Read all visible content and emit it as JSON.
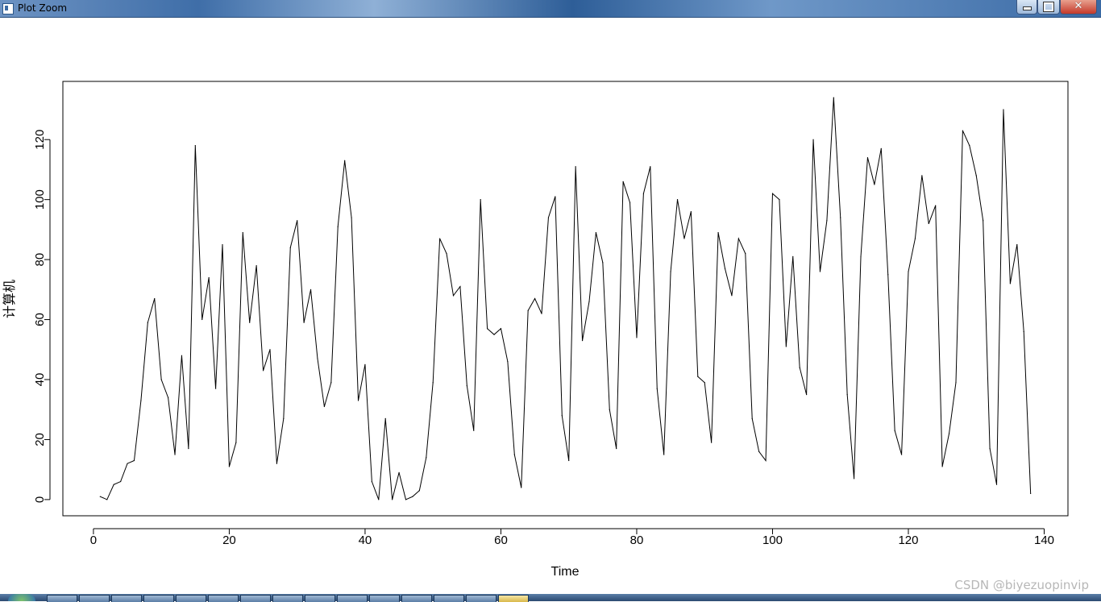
{
  "window": {
    "title": "Plot Zoom",
    "minimize_glyph": "",
    "maximize_glyph": "",
    "close_glyph": "✕"
  },
  "watermark": "CSDN @biyezuopinvip",
  "chart_data": {
    "type": "line",
    "title": "",
    "xlabel": "Time",
    "ylabel": "计算机",
    "xlim": [
      -4.5,
      143.5
    ],
    "ylim": [
      -5.4,
      139.4
    ],
    "xticks": [
      0,
      20,
      40,
      60,
      80,
      100,
      120,
      140
    ],
    "yticks": [
      0,
      20,
      40,
      60,
      80,
      100,
      120
    ],
    "grid": false,
    "line_color": "#000000",
    "series": [
      {
        "x": [
          1,
          2,
          3,
          4,
          5,
          6,
          7,
          8,
          9,
          10,
          11,
          12,
          13,
          14,
          15,
          16,
          17,
          18,
          19,
          20,
          21,
          22,
          23,
          24,
          25,
          26,
          27,
          28,
          29,
          30,
          31,
          32,
          33,
          34,
          35,
          36,
          37,
          38,
          39,
          40,
          41,
          42,
          43,
          44,
          45,
          46,
          47,
          48,
          49,
          50,
          51,
          52,
          53,
          54,
          55,
          56,
          57,
          58,
          59,
          60,
          61,
          62,
          63,
          64,
          65,
          66,
          67,
          68,
          69,
          70,
          71,
          72,
          73,
          74,
          75,
          76,
          77,
          78,
          79,
          80,
          81,
          82,
          83,
          84,
          85,
          86,
          87,
          88,
          89,
          90,
          91,
          92,
          93,
          94,
          95,
          96,
          97,
          98,
          99,
          100,
          101,
          102,
          103,
          104,
          105,
          106,
          107,
          108,
          109,
          110,
          111,
          112,
          113,
          114,
          115,
          116,
          117,
          118,
          119,
          120,
          121,
          122,
          123,
          124,
          125,
          126,
          127,
          128,
          129,
          130,
          131,
          132,
          133,
          134,
          135,
          136,
          137,
          138
        ],
        "values": [
          1,
          0,
          5,
          6,
          12,
          13,
          33,
          59,
          67,
          40,
          34,
          15,
          48,
          17,
          118,
          60,
          74,
          37,
          85,
          11,
          19,
          89,
          59,
          78,
          43,
          50,
          12,
          27,
          84,
          93,
          59,
          70,
          47,
          31,
          39,
          91,
          113,
          94,
          33,
          45,
          6,
          0,
          27,
          0,
          9,
          0,
          1,
          3,
          14,
          39,
          87,
          82,
          68,
          71,
          38,
          23,
          100,
          57,
          55,
          57,
          46,
          15,
          4,
          63,
          67,
          62,
          94,
          101,
          28,
          13,
          111,
          53,
          66,
          89,
          79,
          30,
          17,
          106,
          99,
          54,
          102,
          111,
          37,
          15,
          76,
          100,
          87,
          96,
          41,
          39,
          19,
          89,
          77,
          68,
          87,
          82,
          27,
          16,
          13,
          102,
          100,
          51,
          81,
          44,
          35,
          120,
          76,
          93,
          134,
          94,
          35,
          7,
          81,
          114,
          105,
          117,
          75,
          23,
          15,
          76,
          87,
          108,
          92,
          98,
          11,
          22,
          39,
          123,
          118,
          108,
          93,
          17,
          5,
          130,
          72,
          85,
          56,
          2
        ]
      }
    ]
  }
}
